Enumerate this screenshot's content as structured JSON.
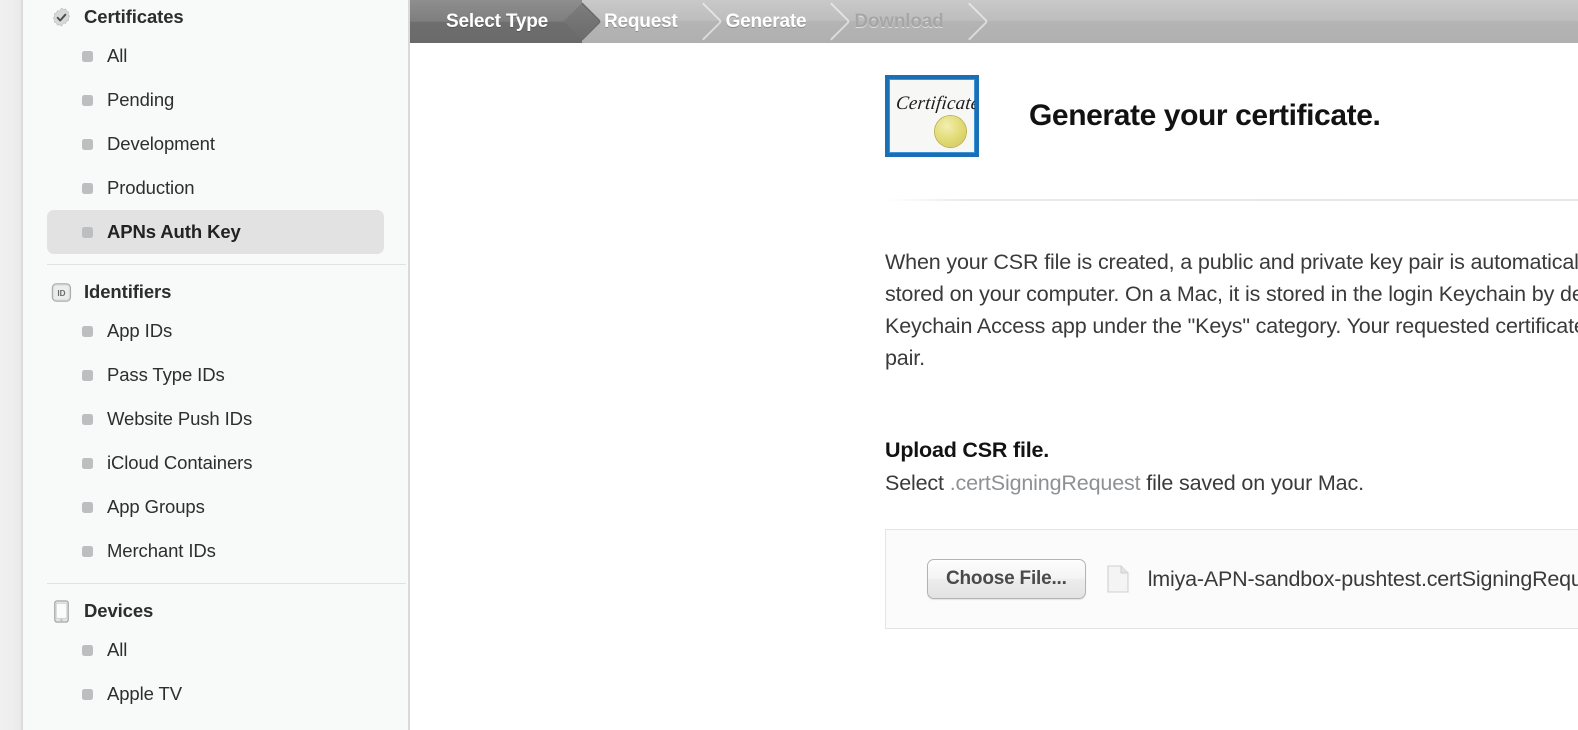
{
  "sidebar": {
    "groups": [
      {
        "title": "Certificates",
        "icon": "seal-check-icon",
        "items": [
          {
            "label": "All",
            "selected": false
          },
          {
            "label": "Pending",
            "selected": false
          },
          {
            "label": "Development",
            "selected": false
          },
          {
            "label": "Production",
            "selected": false
          },
          {
            "label": "APNs Auth Key",
            "selected": true
          }
        ]
      },
      {
        "title": "Identifiers",
        "icon": "id-badge-icon",
        "icon_text": "ID",
        "items": [
          {
            "label": "App IDs",
            "selected": false
          },
          {
            "label": "Pass Type IDs",
            "selected": false
          },
          {
            "label": "Website Push IDs",
            "selected": false
          },
          {
            "label": "iCloud Containers",
            "selected": false
          },
          {
            "label": "App Groups",
            "selected": false
          },
          {
            "label": "Merchant IDs",
            "selected": false
          }
        ]
      },
      {
        "title": "Devices",
        "icon": "device-icon",
        "items": [
          {
            "label": "All",
            "selected": false
          },
          {
            "label": "Apple TV",
            "selected": false
          }
        ]
      }
    ]
  },
  "steps": [
    {
      "label": "Select Type",
      "state": "active"
    },
    {
      "label": "Request",
      "state": "upcoming"
    },
    {
      "label": "Generate",
      "state": "upcoming"
    },
    {
      "label": "Download",
      "state": "disabled"
    }
  ],
  "hero": {
    "badge_word": "Certificate",
    "title": "Generate your certificate."
  },
  "body": {
    "paragraph": "When your CSR file is created, a public and private key pair is automatically generated. Your private key is stored on your computer. On a Mac, it is stored in the login Keychain by default and can be viewed in the Keychain Access app under the \"Keys\" category. Your requested certificate is the public half of your key pair."
  },
  "upload": {
    "heading": "Upload CSR file.",
    "sub_prefix": "Select ",
    "sub_ext": ".certSigningRequest",
    "sub_suffix": " file saved on your Mac.",
    "choose_button": "Choose File...",
    "file_name": "lmiya-APN-sandbox-pushtest.certSigningRequest"
  },
  "colors": {
    "sidebar_bg": "#f8f9f9",
    "selected_item_bg": "#e2e2e2",
    "step_bar_bg": "#bdbdbd",
    "step_active_bg": "#6e6e6e",
    "cert_border_blue": "#1b6fb5",
    "cert_seal_gold": "#e3dc78",
    "muted_text": "#8d9193"
  }
}
